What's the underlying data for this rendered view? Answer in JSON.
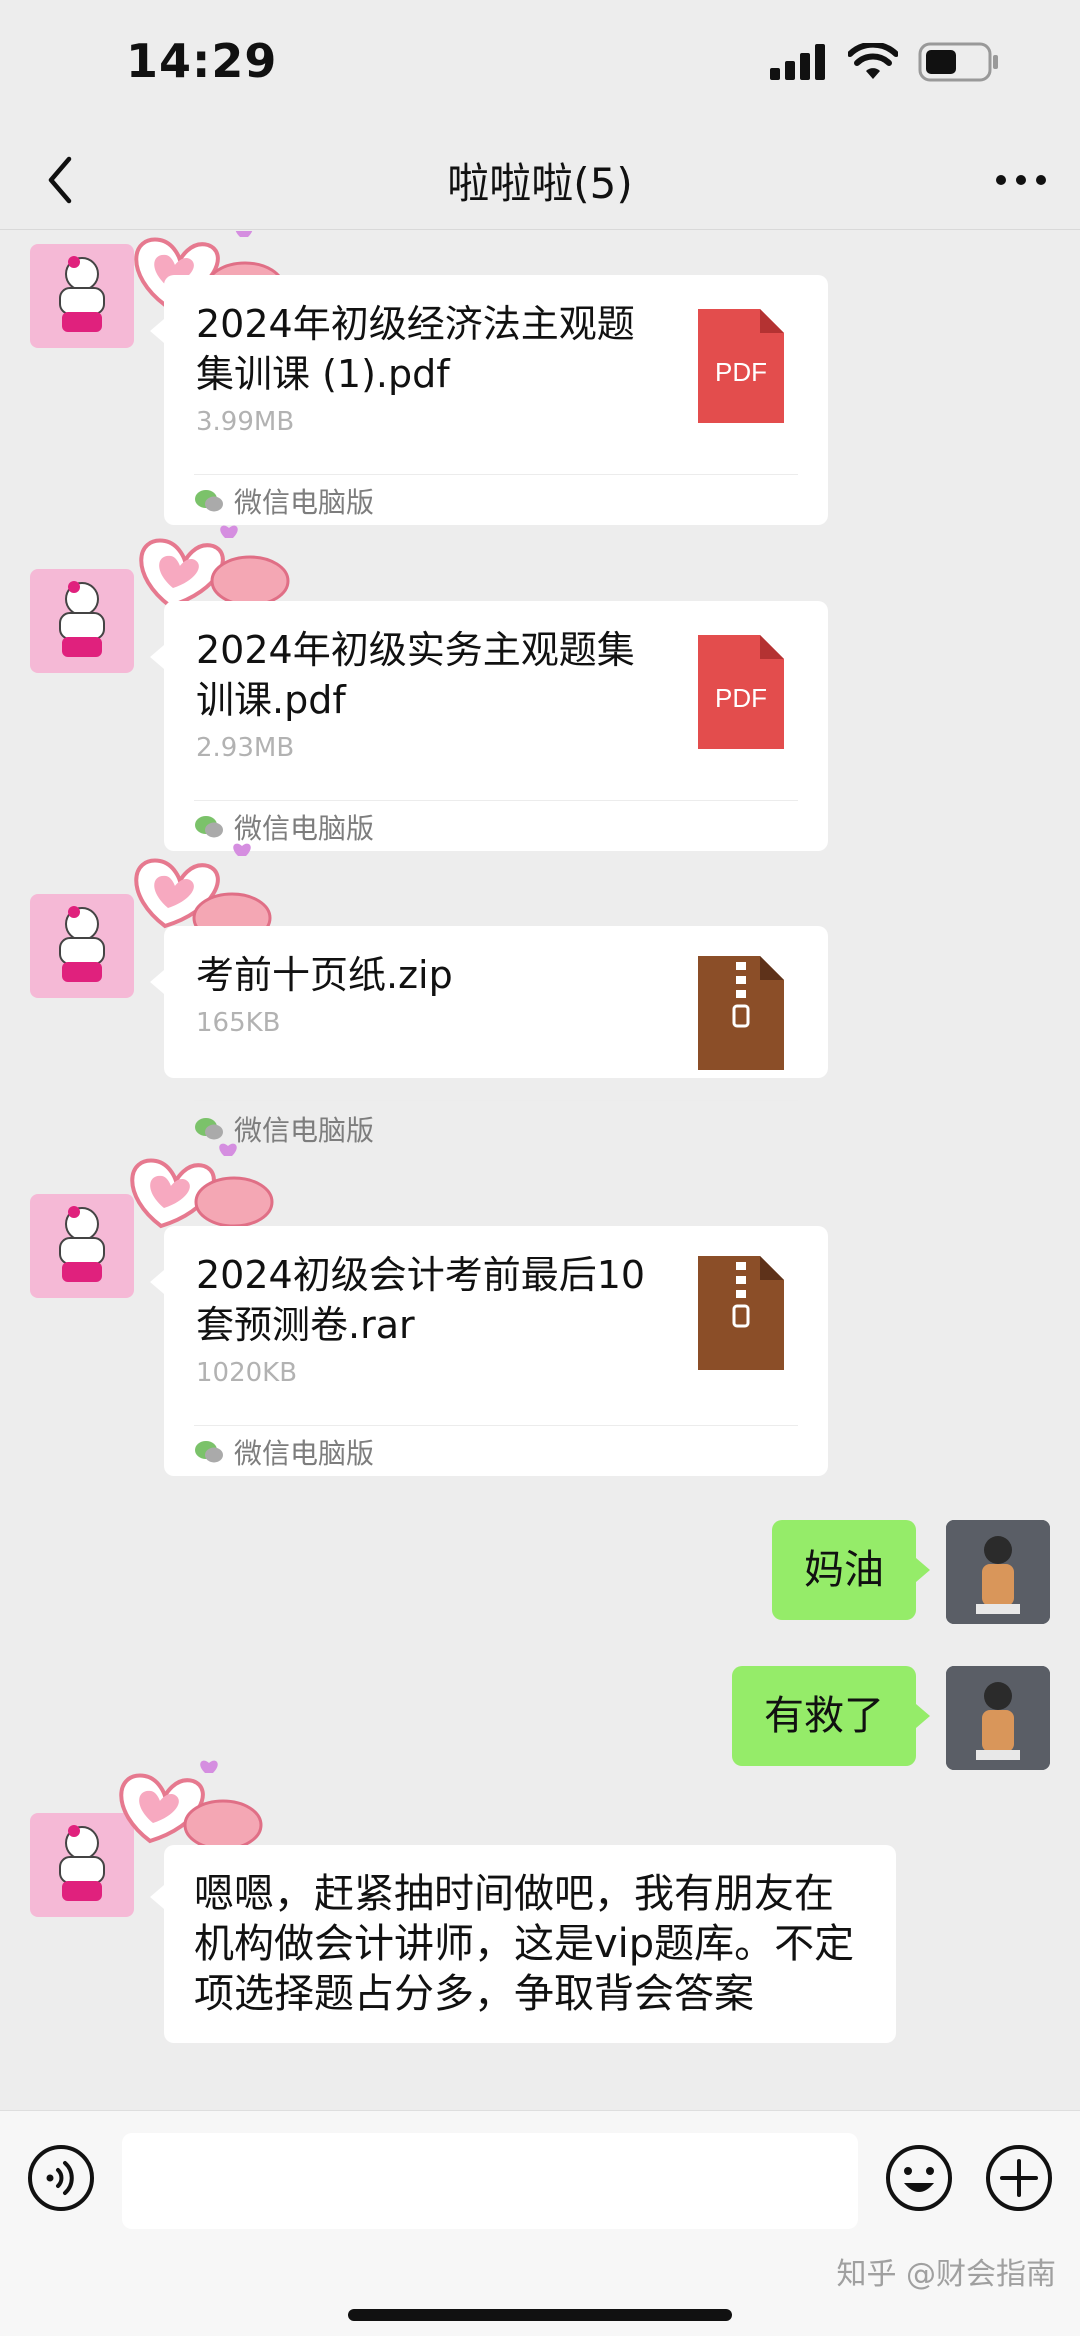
{
  "status_bar": {
    "time": "14:29",
    "icons": [
      "signal-icon",
      "wifi-icon",
      "battery-icon"
    ]
  },
  "header": {
    "title": "啦啦啦(5)",
    "back_icon": "chevron-left-icon",
    "more_icon": "more-icon"
  },
  "messages": [
    {
      "type": "file",
      "name": "2024年初级经济法主观题集训课 (1).pdf",
      "size": "3.99MB",
      "file_type": "PDF",
      "source": "微信电脑版"
    },
    {
      "type": "file",
      "name": "2024年初级实务主观题集训课.pdf",
      "size": "2.93MB",
      "file_type": "PDF",
      "source": "微信电脑版"
    },
    {
      "type": "file",
      "name": "考前十页纸.zip",
      "size": "165KB",
      "file_type": "ZIP",
      "source": "微信电脑版"
    },
    {
      "type": "file",
      "name": "2024初级会计考前最后10套预测卷.rar",
      "size": "1020KB",
      "file_type": "RAR",
      "source": "微信电脑版"
    },
    {
      "type": "text",
      "sender": "self",
      "text": "妈油"
    },
    {
      "type": "text",
      "sender": "self",
      "text": "有救了"
    },
    {
      "type": "text",
      "sender": "other",
      "text": "嗯嗯，赶紧抽时间做吧，我有朋友在机构做会计讲师，这是vip题库。不定项选择题占分多，争取背会答案"
    }
  ],
  "input_bar": {
    "placeholder": "",
    "icons": [
      "voice-icon",
      "emoji-icon",
      "plus-icon"
    ]
  },
  "watermark": "知乎 @财会指南",
  "colors": {
    "background": "#ededed",
    "self_bubble": "#95ec69",
    "pdf_red": "#e34d4d",
    "archive_brown": "#8b4e28"
  }
}
